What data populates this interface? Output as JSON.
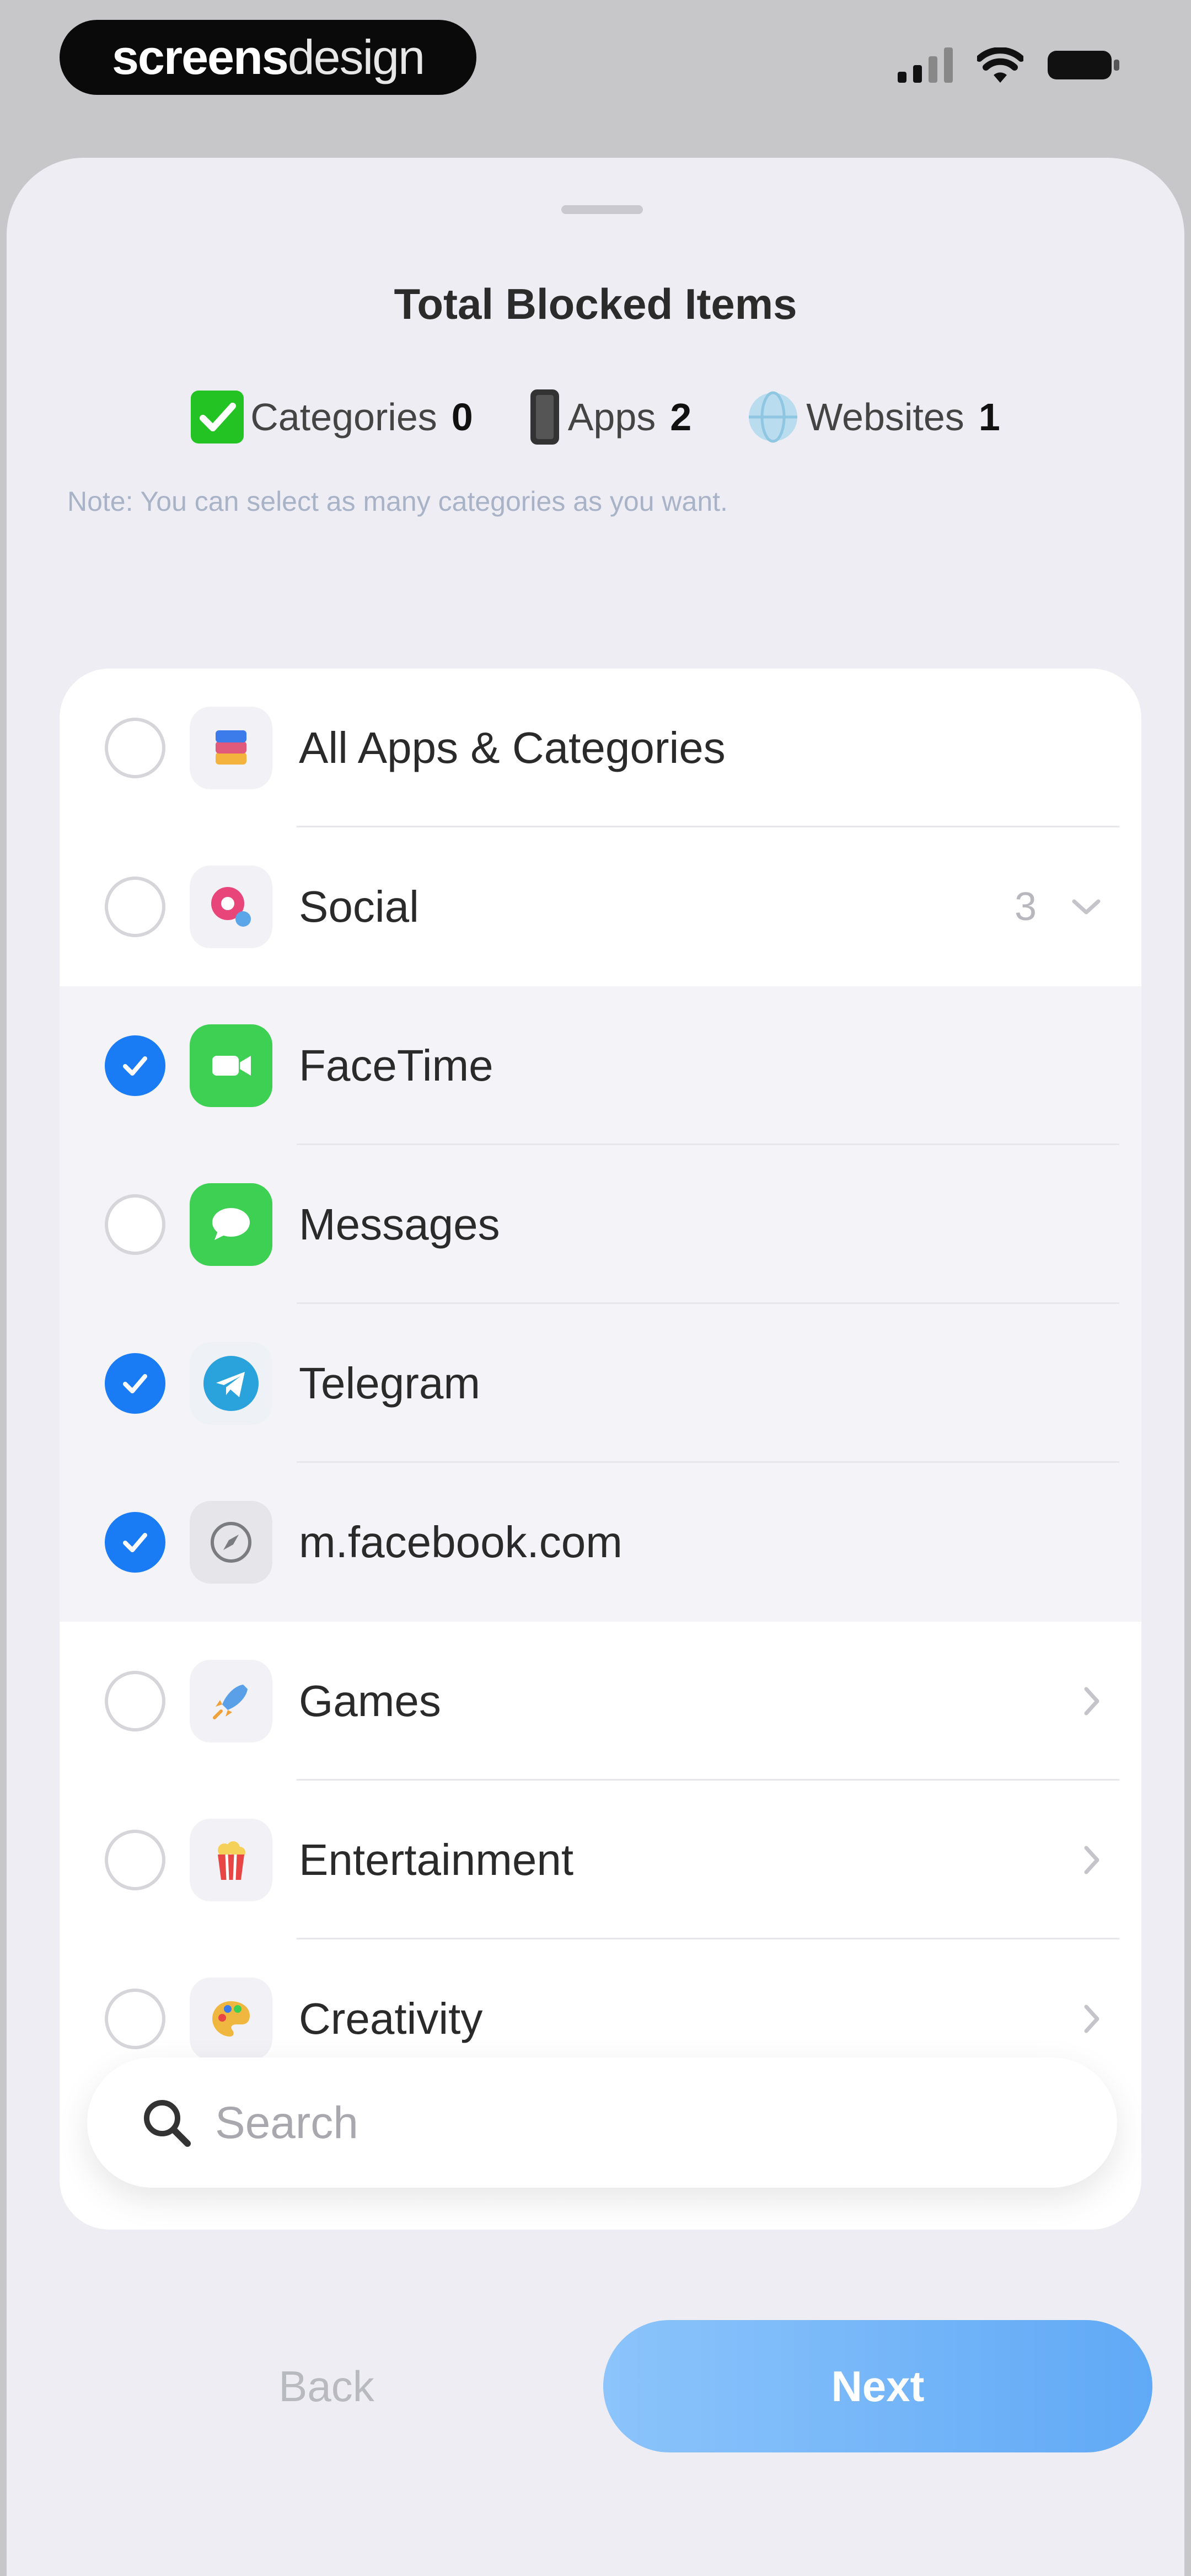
{
  "watermark": {
    "bold": "screens",
    "light": "design"
  },
  "header": {
    "title": "Total Blocked Items",
    "counts": [
      {
        "label": "Categories",
        "value": "0"
      },
      {
        "label": "Apps",
        "value": "2"
      },
      {
        "label": "Websites",
        "value": "1"
      }
    ],
    "note": "Note: You can select as many categories as you want."
  },
  "list": {
    "items": [
      {
        "label": "All Apps & Categories",
        "checked": false,
        "icon": "stack-icon"
      },
      {
        "label": "Social",
        "checked": false,
        "icon": "social-bubble-icon",
        "count": "3",
        "expanded": true
      },
      {
        "label": "FaceTime",
        "checked": true,
        "icon": "facetime-icon"
      },
      {
        "label": "Messages",
        "checked": false,
        "icon": "messages-icon"
      },
      {
        "label": "Telegram",
        "checked": true,
        "icon": "telegram-icon"
      },
      {
        "label": "m.facebook.com",
        "checked": true,
        "icon": "compass-icon"
      },
      {
        "label": "Games",
        "checked": false,
        "icon": "rocket-icon"
      },
      {
        "label": "Entertainment",
        "checked": false,
        "icon": "popcorn-icon"
      },
      {
        "label": "Creativity",
        "checked": false,
        "icon": "palette-icon"
      }
    ]
  },
  "search": {
    "placeholder": "Search"
  },
  "footer": {
    "back_label": "Back",
    "next_label": "Next"
  },
  "colors": {
    "accent": "#1a7cf5",
    "next_button": "#6aaef7",
    "sheet": "#ededf3"
  }
}
